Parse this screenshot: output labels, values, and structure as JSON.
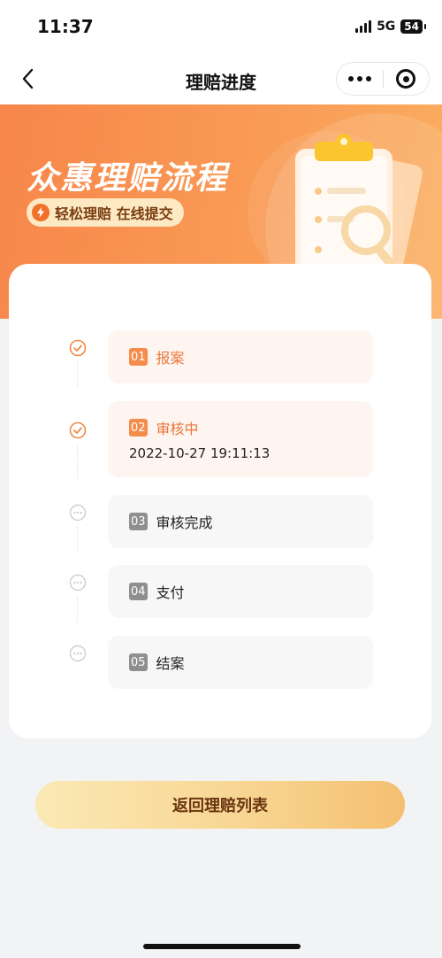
{
  "status_bar": {
    "time": "11:37",
    "network": "5G",
    "battery": "54"
  },
  "nav": {
    "title": "理赔进度"
  },
  "banner": {
    "title": "众惠理赔流程",
    "tag": "轻松理赔 在线提交"
  },
  "steps": [
    {
      "num": "01",
      "label": "报案",
      "status": "done",
      "time": ""
    },
    {
      "num": "02",
      "label": "审核中",
      "status": "done",
      "time": "2022-10-27 19:11:13"
    },
    {
      "num": "03",
      "label": "审核完成",
      "status": "todo",
      "time": ""
    },
    {
      "num": "04",
      "label": "支付",
      "status": "todo",
      "time": ""
    },
    {
      "num": "05",
      "label": "结案",
      "status": "todo",
      "time": ""
    }
  ],
  "button": {
    "label": "返回理赔列表"
  },
  "colors": {
    "accent": "#f58c4c",
    "banner_start": "#f7864a",
    "banner_end": "#fbae60",
    "done_bg": "#fff5f0",
    "todo_bg": "#f7f7f7"
  }
}
